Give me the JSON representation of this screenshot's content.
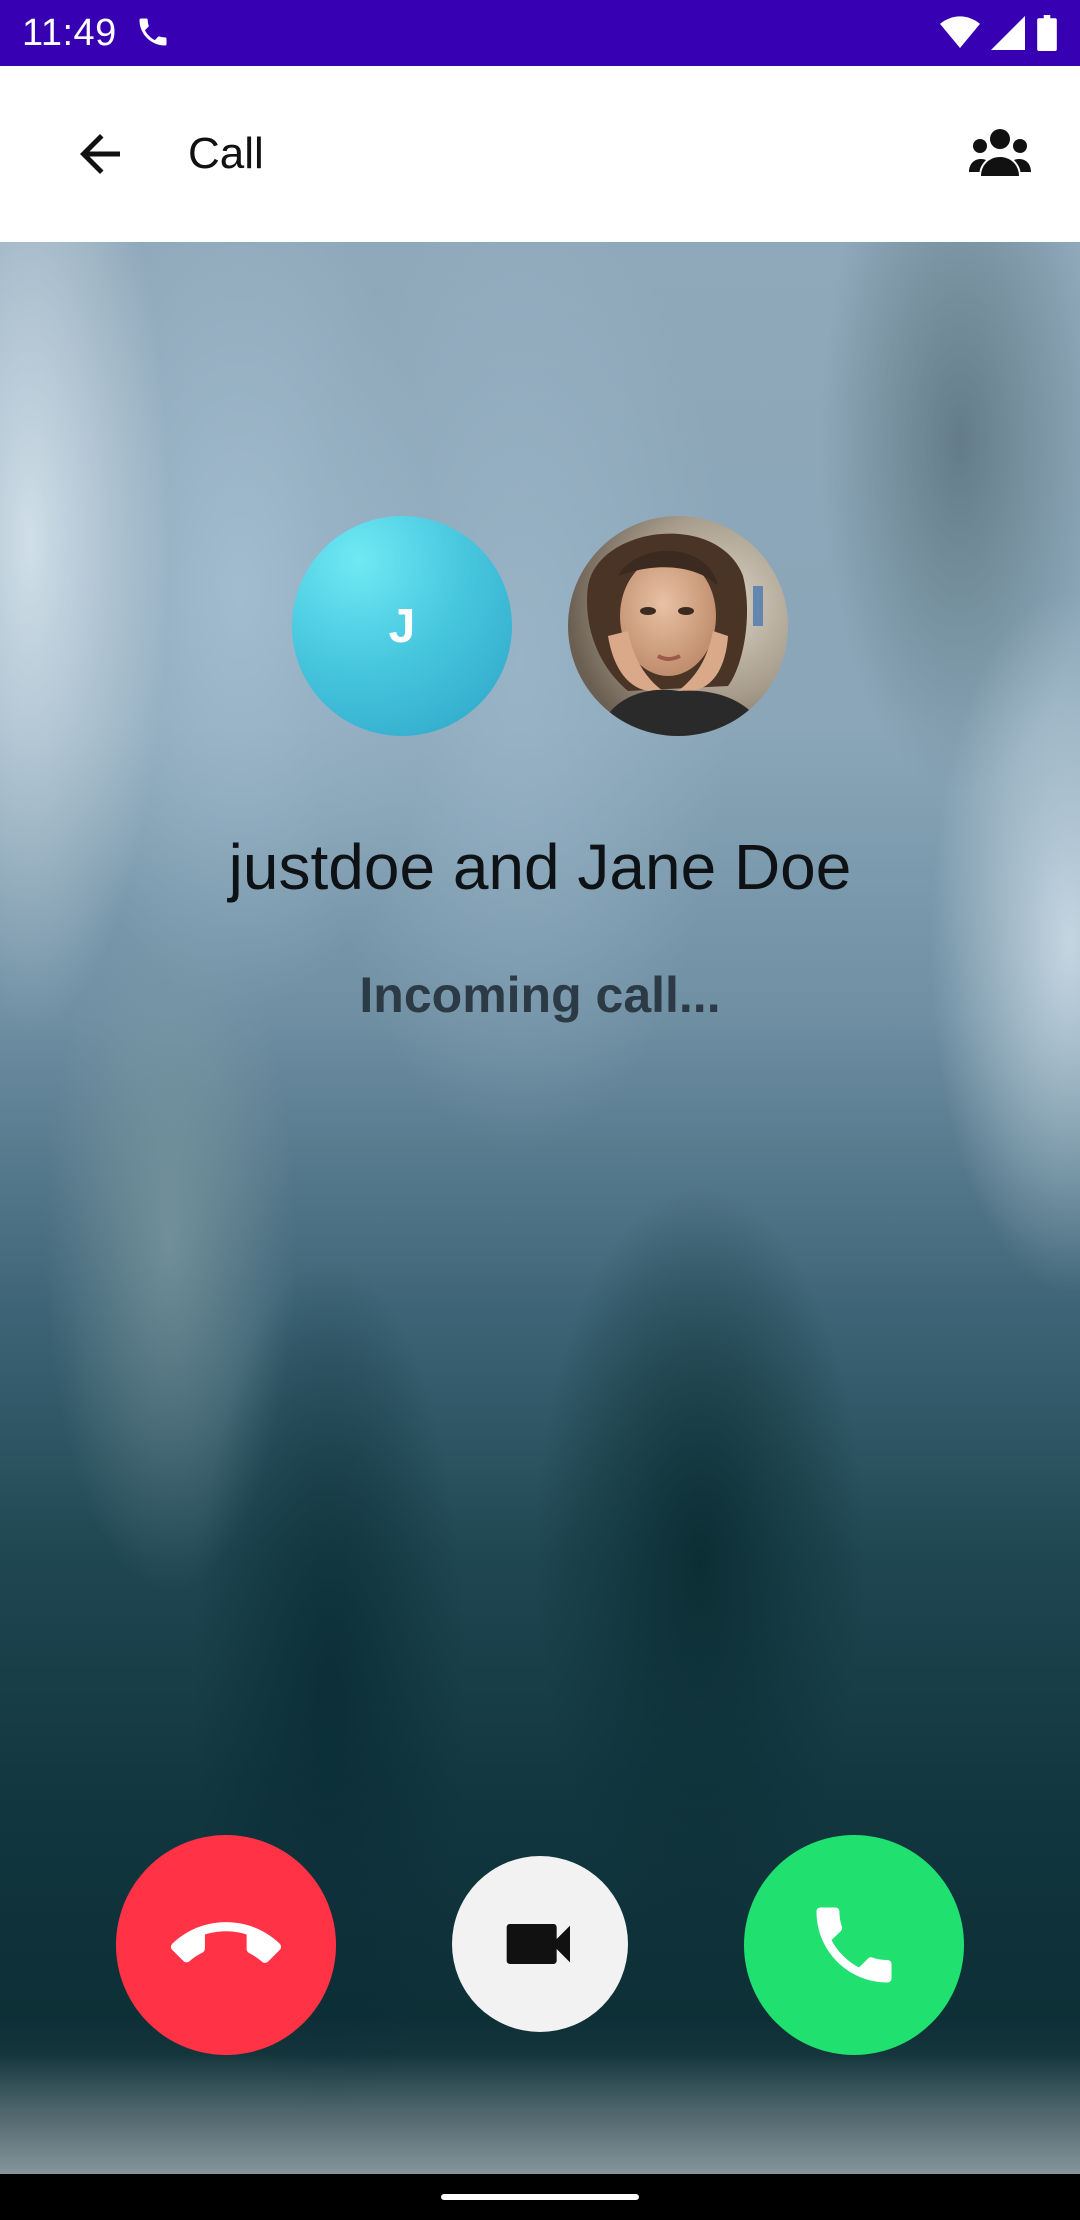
{
  "status_bar": {
    "time": "11:49",
    "icons": [
      "phone-call-icon",
      "wifi-icon",
      "signal-icon",
      "battery-icon"
    ]
  },
  "app_bar": {
    "title": "Call",
    "back_icon": "arrow-back-icon",
    "participants_icon": "group-icon"
  },
  "call": {
    "avatar_initial": "J",
    "caller_names": "justdoe and Jane Doe",
    "status": "Incoming call..."
  },
  "actions": [
    {
      "name": "decline",
      "icon": "call-end-icon",
      "color": "#ff3246"
    },
    {
      "name": "video",
      "icon": "videocam-icon",
      "color": "#f2f2f2"
    },
    {
      "name": "accept",
      "icon": "phone-icon",
      "color": "#20e070"
    }
  ],
  "colors": {
    "status_bar": "#3700b3",
    "app_bar": "#ffffff",
    "decline": "#ff3246",
    "accept": "#20e070"
  }
}
